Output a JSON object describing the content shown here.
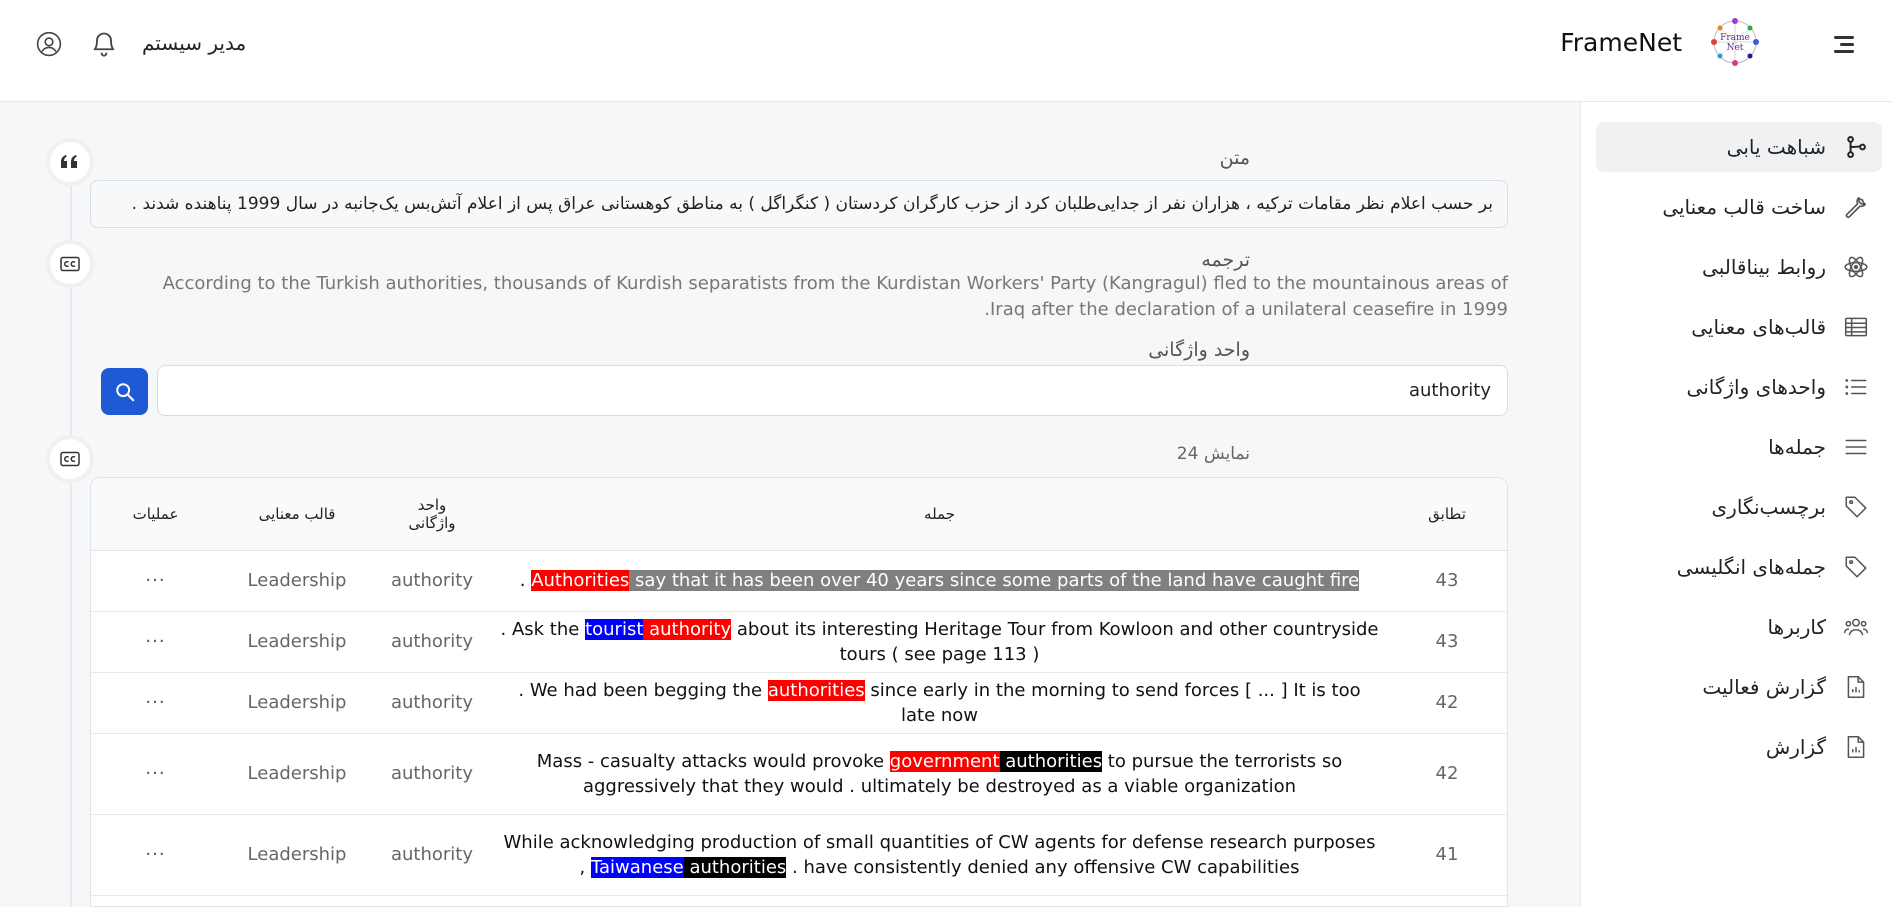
{
  "header": {
    "brand_name": "FrameNet",
    "user_name": "مدیر سیستم"
  },
  "sidebar": {
    "items": [
      {
        "label": "شباهت یابی",
        "icon": "branch-icon",
        "active": true
      },
      {
        "label": "ساخت قالب معنایی",
        "icon": "wrench-icon",
        "active": false
      },
      {
        "label": "روابط بیناقالبی",
        "icon": "atom-icon",
        "active": false
      },
      {
        "label": "قالب‌های معنایی",
        "icon": "table-icon",
        "active": false
      },
      {
        "label": "واحدهای واژگانی",
        "icon": "list-icon",
        "active": false
      },
      {
        "label": "جمله‌ها",
        "icon": "lines-icon",
        "active": false
      },
      {
        "label": "برچسب‌نگاری",
        "icon": "tag-icon",
        "active": false
      },
      {
        "label": "جمله‌های انگلیسی",
        "icon": "tag-icon",
        "active": false
      },
      {
        "label": "کاربرها",
        "icon": "users-icon",
        "active": false
      },
      {
        "label": "گزارش فعالیت",
        "icon": "file-chart-icon",
        "active": false
      },
      {
        "label": "گزارش",
        "icon": "file-chart-icon",
        "active": false
      }
    ]
  },
  "main": {
    "text_label": "متن",
    "text_value": "بر حسب اعلام نظر مقامات ترکیه ، هزاران نفر از جدایی‌طلبان کرد از حزب کارگران کردستان ( کنگراگل ) به مناطق کوهستانی عراق پس از اعلام آتش‌بس یک‌جانبه در سال 1999 پناهنده شدند .",
    "translation_label": "ترجمه",
    "translation_value": "According to the Turkish authorities, thousands of Kurdish separatists from the Kurdistan Workers' Party (Kangragul) fled to the mountainous areas of Iraq after the declaration of a unilateral ceasefire in 1999.",
    "lexical_unit_label": "واحد واژگانی",
    "lexical_unit_value": "authority",
    "count_label": "نمایش 24"
  },
  "table": {
    "headers": {
      "score": "تطابق",
      "sentence": "جمله",
      "lexical_unit": "واحد واژگانی",
      "frame": "قالب معنایی",
      "operations": "عملیات"
    },
    "rows": [
      {
        "score": "43",
        "lexical_unit": "authority",
        "frame": "Leadership",
        "ops": "···",
        "segments": [
          {
            "text": ". ",
            "hl": ""
          },
          {
            "text": " ",
            "hl": "gray"
          },
          {
            "text": "Authorities",
            "hl": "red"
          },
          {
            "text": " say that it has been over 40 years since some parts of the land have caught fire",
            "hl": "gray"
          }
        ]
      },
      {
        "score": "43",
        "lexical_unit": "authority",
        "frame": "Leadership",
        "ops": "···",
        "segments": [
          {
            "text": ". Ask the ",
            "hl": ""
          },
          {
            "text": "tourist",
            "hl": "blue"
          },
          {
            "text": " authority",
            "hl": "red"
          },
          {
            "text": " about its interesting Heritage Tour from Kowloon and other countryside tours ( see page 113 )",
            "hl": ""
          }
        ]
      },
      {
        "score": "42",
        "lexical_unit": "authority",
        "frame": "Leadership",
        "ops": "···",
        "segments": [
          {
            "text": ". We had been begging the ",
            "hl": ""
          },
          {
            "text": "authorities",
            "hl": "red"
          },
          {
            "text": " since early in the morning to send forces [ ... ] It is too late now",
            "hl": ""
          }
        ]
      },
      {
        "score": "42",
        "lexical_unit": "authority",
        "frame": "Leadership",
        "ops": "···",
        "segments": [
          {
            "text": "Mass - casualty attacks would provoke ",
            "hl": ""
          },
          {
            "text": "government",
            "hl": "red"
          },
          {
            "text": " authorities",
            "hl": "black"
          },
          {
            "text": " to pursue the terrorists so aggressively that they would . ultimately be destroyed as a viable organization",
            "hl": ""
          }
        ]
      },
      {
        "score": "41",
        "lexical_unit": "authority",
        "frame": "Leadership",
        "ops": "···",
        "segments": [
          {
            "text": "While acknowledging production of small quantities of CW agents for defense research purposes , ",
            "hl": ""
          },
          {
            "text": "Taiwanese",
            "hl": "blue"
          },
          {
            "text": " authorities",
            "hl": "black"
          },
          {
            "text": " . have consistently denied any offensive CW capabilities",
            "hl": ""
          }
        ]
      }
    ]
  },
  "colors": {
    "primary": "#1f5ad6",
    "highlight_red": "#ff0000",
    "highlight_blue": "#0000ff",
    "highlight_black": "#000000",
    "highlight_gray": "#808080"
  }
}
